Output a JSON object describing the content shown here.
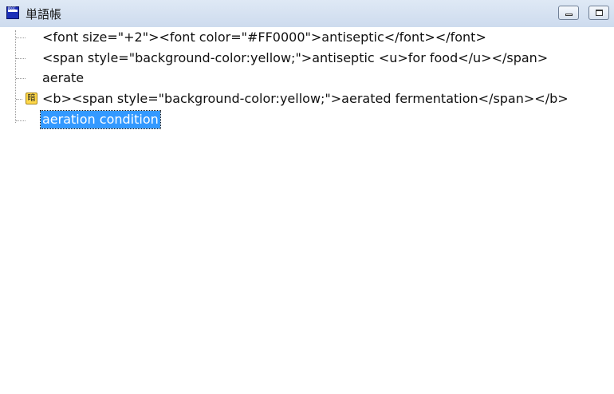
{
  "window": {
    "title": "単語帳",
    "app_icon_text": "PDIC"
  },
  "tree": {
    "items": [
      {
        "label": "<font size=\"+2\"><font color=\"#FF0000\">antiseptic</font></font>"
      },
      {
        "label": "<span style=\"background-color:yellow;\">antiseptic <u>for food</u></span>"
      },
      {
        "label": "aerate"
      },
      {
        "label": "<b><span style=\"background-color:yellow;\">aerated fermentation</span></b>",
        "badge": "暗"
      },
      {
        "label": "aeration condition",
        "selected": true
      }
    ]
  },
  "colors": {
    "selection": "#3399ff",
    "badge": "#ffd84a"
  }
}
